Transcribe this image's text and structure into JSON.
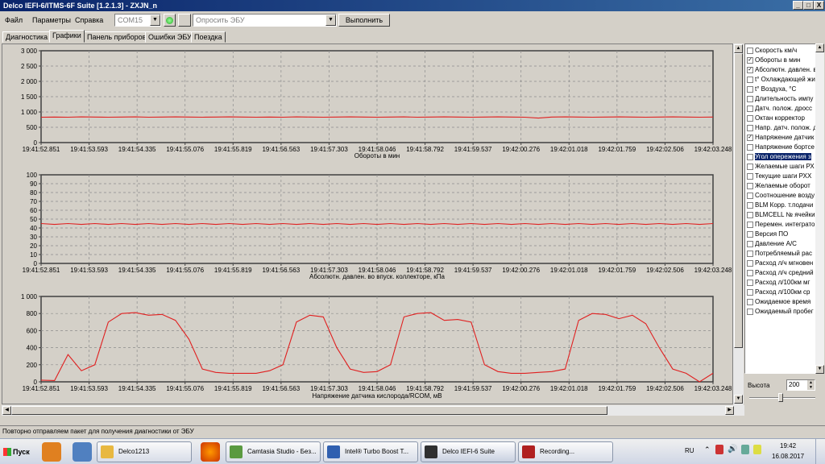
{
  "window": {
    "title": "Delco IEFI-6/ITMS-6F Suite [1.2.1.3] - ZXJN_n",
    "min": "_",
    "max": "□",
    "close": "X"
  },
  "menu": {
    "items": [
      "Файл",
      "Параметры",
      "Справка"
    ]
  },
  "toolbar": {
    "port_value": "COM15",
    "command_value": "Опросить ЭБУ",
    "execute_label": "Выполнить"
  },
  "tabs": [
    {
      "label": "Диагностика",
      "active": false
    },
    {
      "label": "Графики",
      "active": true
    },
    {
      "label": "Панель приборов",
      "active": false
    },
    {
      "label": "Ошибки ЭБУ",
      "active": false
    },
    {
      "label": "Поездка",
      "active": false
    }
  ],
  "time_labels": [
    "19:41:52.851",
    "19:41:53.593",
    "19:41:54.335",
    "19:41:55.076",
    "19:41:55.819",
    "19:41:56.563",
    "19:41:57.303",
    "19:41:58.046",
    "19:41:58.792",
    "19:41:59.537",
    "19:42:00.276",
    "19:42:01.018",
    "19:42:01.759",
    "19:42:02.506",
    "19:42:03.248"
  ],
  "chart_data": [
    {
      "type": "line",
      "title": "Обороты в мин",
      "ylim": [
        0,
        3000
      ],
      "yticks": [
        0,
        500,
        1000,
        1500,
        2000,
        2500,
        3000
      ],
      "ytick_labels": [
        "0",
        "500",
        "1 000",
        "1 500",
        "2 000",
        "2 500",
        "3 000"
      ],
      "grid": true,
      "series": [
        {
          "values": [
            830,
            835,
            830,
            840,
            835,
            830,
            835,
            840,
            830,
            835,
            840,
            835,
            830,
            835,
            840,
            835,
            830,
            835,
            830,
            840,
            835,
            830,
            835,
            840,
            835,
            830,
            835,
            840,
            830,
            835,
            840,
            835,
            830,
            835,
            840,
            835,
            830,
            800,
            835,
            840,
            835,
            830,
            835,
            840,
            835,
            830,
            835,
            840,
            835,
            830,
            835
          ]
        }
      ]
    },
    {
      "type": "line",
      "title": "Абсолютн. давлен. во впуск. коллекторе, кПа",
      "ylim": [
        0,
        100
      ],
      "yticks": [
        0,
        10,
        20,
        30,
        40,
        50,
        60,
        70,
        80,
        90,
        100
      ],
      "ytick_labels": [
        "0",
        "10",
        "20",
        "30",
        "40",
        "50",
        "60",
        "70",
        "80",
        "90",
        "100"
      ],
      "grid": true,
      "series": [
        {
          "values": [
            45,
            44,
            45,
            44,
            45,
            44,
            45,
            44,
            45,
            44,
            45,
            44,
            45,
            44,
            45,
            44,
            45,
            44,
            45,
            44,
            45,
            44,
            45,
            44,
            45,
            44,
            45,
            44,
            45,
            44,
            45,
            44,
            45,
            44,
            45,
            44,
            45,
            44,
            45,
            44,
            45,
            44,
            45,
            44,
            45,
            44,
            45,
            44,
            45,
            44,
            45
          ]
        }
      ]
    },
    {
      "type": "line",
      "title": "Напряжение датчика кислорода/RCOM, мВ",
      "ylim": [
        0,
        1000
      ],
      "yticks": [
        0,
        200,
        400,
        600,
        800,
        1000
      ],
      "ytick_labels": [
        "0",
        "200",
        "400",
        "600",
        "800",
        "1 000"
      ],
      "grid": true,
      "series": [
        {
          "values": [
            20,
            15,
            320,
            130,
            200,
            700,
            800,
            810,
            780,
            790,
            720,
            500,
            150,
            110,
            100,
            100,
            100,
            130,
            200,
            700,
            780,
            760,
            400,
            150,
            110,
            120,
            200,
            760,
            800,
            810,
            720,
            730,
            700,
            200,
            120,
            100,
            100,
            110,
            120,
            150,
            720,
            800,
            790,
            740,
            780,
            680,
            400,
            150,
            100,
            0,
            100
          ]
        }
      ]
    }
  ],
  "params": [
    {
      "label": "Скорость км/ч",
      "checked": false,
      "selected": false
    },
    {
      "label": "Обороты в мин",
      "checked": true,
      "selected": false
    },
    {
      "label": "Абсолютн. давлен. в",
      "checked": true,
      "selected": false
    },
    {
      "label": "t° Охлаждающей жи",
      "checked": false,
      "selected": false
    },
    {
      "label": "t° Воздуха, °С",
      "checked": false,
      "selected": false
    },
    {
      "label": "Длительность импу",
      "checked": false,
      "selected": false
    },
    {
      "label": "Датч. полож. дросс",
      "checked": false,
      "selected": false
    },
    {
      "label": "Октан корректор",
      "checked": false,
      "selected": false
    },
    {
      "label": "Напр. датч. полож. д",
      "checked": false,
      "selected": false
    },
    {
      "label": "Напряжение датчик",
      "checked": true,
      "selected": false
    },
    {
      "label": "Напряжение бортсе",
      "checked": false,
      "selected": false
    },
    {
      "label": "Угол опережения з",
      "checked": false,
      "selected": true
    },
    {
      "label": "Желаемые шаги РХ",
      "checked": false,
      "selected": false
    },
    {
      "label": "Текущие шаги РХХ",
      "checked": false,
      "selected": false
    },
    {
      "label": "Желаемые оборот",
      "checked": false,
      "selected": false
    },
    {
      "label": "Соотношение возду",
      "checked": false,
      "selected": false
    },
    {
      "label": "BLM Корр. т.подачи",
      "checked": false,
      "selected": false
    },
    {
      "label": "BLMCELL № ячейки",
      "checked": false,
      "selected": false
    },
    {
      "label": "Перемен. интеграто",
      "checked": false,
      "selected": false
    },
    {
      "label": "Версия ПО",
      "checked": false,
      "selected": false
    },
    {
      "label": "Давление A/C",
      "checked": false,
      "selected": false
    },
    {
      "label": "Потребляемый рас",
      "checked": false,
      "selected": false
    },
    {
      "label": "Расход л/ч мгновен",
      "checked": false,
      "selected": false
    },
    {
      "label": "Расход л/ч средний",
      "checked": false,
      "selected": false
    },
    {
      "label": "Расход л/100км мг",
      "checked": false,
      "selected": false
    },
    {
      "label": "Расход л/100км ср",
      "checked": false,
      "selected": false
    },
    {
      "label": "Ожидаемое время",
      "checked": false,
      "selected": false
    },
    {
      "label": "Ожидаемый пробег",
      "checked": false,
      "selected": false
    }
  ],
  "height_control": {
    "label": "Высота",
    "value": "200"
  },
  "status": {
    "text": "Повторно отправляем пакет для получения диагностики от ЭБУ"
  },
  "taskbar": {
    "start_label": "Пуск",
    "items": [
      {
        "label": "Delco1213",
        "color": "#e8b840"
      },
      {
        "label": "Camtasia Studio - Без...",
        "color": "#5a9a40"
      },
      {
        "label": "Intel® Turbo Boost T...",
        "color": "#3060b0"
      },
      {
        "label": "Delco IEFI-6 Suite",
        "color": "#303030"
      },
      {
        "label": "Recording...",
        "color": "#b02020"
      }
    ],
    "lang": "RU",
    "time": "19:42",
    "date": "16.08.2017"
  },
  "colors": {
    "line": "#e02020",
    "plot_bg": "#d4d0c8",
    "grid": "#8c8c8c"
  }
}
